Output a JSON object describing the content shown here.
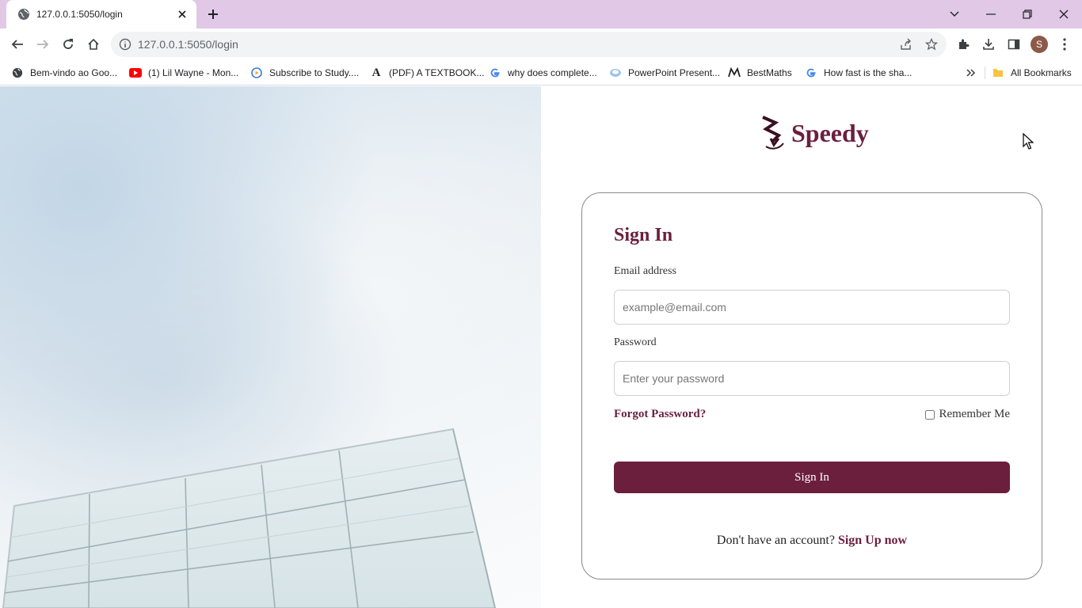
{
  "browser": {
    "tab_title": "127.0.0.1:5050/login",
    "url": "127.0.0.1:5050/login",
    "profile_initial": "S",
    "bookmarks": [
      {
        "label": "Bem-vindo ao Goo...",
        "icon": "globe-icon"
      },
      {
        "label": "(1) Lil Wayne - Mon...",
        "icon": "youtube-icon"
      },
      {
        "label": "Subscribe to Study....",
        "icon": "play-circle-icon"
      },
      {
        "label": "(PDF) A TEXTBOOK...",
        "icon": "academia-icon"
      },
      {
        "label": "why does complete...",
        "icon": "google-icon"
      },
      {
        "label": "PowerPoint Present...",
        "icon": "slides-icon"
      },
      {
        "label": "BestMaths",
        "icon": "bestmaths-icon"
      },
      {
        "label": "How fast is the sha...",
        "icon": "google-icon"
      }
    ],
    "all_bookmarks_label": "All Bookmarks"
  },
  "page": {
    "brand_name": "Speedy",
    "form": {
      "title": "Sign In",
      "email_label": "Email address",
      "email_placeholder": "example@email.com",
      "email_value": "",
      "password_label": "Password",
      "password_placeholder": "Enter your password",
      "password_value": "",
      "forgot_label": "Forgot Password?",
      "remember_label": "Remember Me",
      "remember_checked": false,
      "submit_label": "Sign In",
      "signup_prompt": "Don't have an account?",
      "signup_link": "Sign Up now"
    }
  },
  "colors": {
    "accent": "#6b1f3d",
    "tabstrip": "#e0c8e6"
  }
}
